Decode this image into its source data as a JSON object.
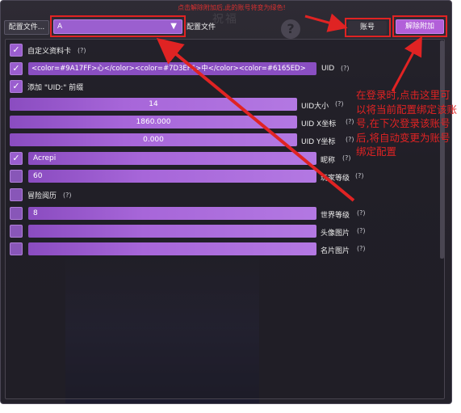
{
  "top_note": "点击解除附加后,此的账号将变为绿色!",
  "bg_watermark": "祝福",
  "toolbar": {
    "profile_file_button": "配置文件...",
    "profile_selected": "A",
    "profile_label": "配置文件",
    "account_button": "账号",
    "unbind_button": "解除附加"
  },
  "settings": {
    "custom_card": {
      "label": "自定义资料卡",
      "checked": true,
      "help": "(?)"
    },
    "uid_row": {
      "value": "<color=#9A17FF>心</color><color=#7D3EF6>中</color><color=#6165ED>",
      "label": "UID",
      "help": "(?)"
    },
    "uid_prefix": {
      "label": "添加 \"UID:\" 前缀",
      "checked": true
    },
    "uid_size": {
      "value": "14",
      "label": "UID大小",
      "help": "(?)"
    },
    "uid_x": {
      "value": "1860.000",
      "label": "UID X坐标",
      "help": "(?)"
    },
    "uid_y": {
      "value": "0.000",
      "label": "UID Y坐标",
      "help": "(?)"
    },
    "nickname": {
      "value": "Acrepi",
      "label": "昵称",
      "help": "(?)"
    },
    "player_level": {
      "value": "60",
      "label": "玩家等级",
      "help": "(?)"
    },
    "adventure": {
      "label": "冒险阅历",
      "help": "(?)"
    },
    "world_level": {
      "value": "8",
      "label": "世界等级",
      "help": "(?)"
    },
    "avatar_image": {
      "value": "",
      "label": "头像图片",
      "help": "(?)"
    },
    "card_image": {
      "value": "",
      "label": "名片图片",
      "help": "(?)"
    }
  },
  "annotation": "在登录时,点击这里可以将当前配置绑定该账号,在下次登录该账号后,将自动变更为账号绑定配置",
  "colors": {
    "accent": "#9b5fcf",
    "annotation_red": "#e02323",
    "background": "#27242d"
  }
}
